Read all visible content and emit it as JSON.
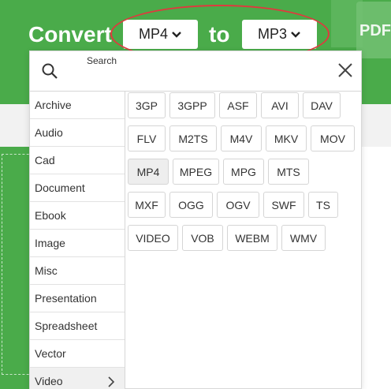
{
  "header": {
    "convert_label": "Convert",
    "to_label": "to",
    "from_format": "MP4",
    "to_format": "MP3",
    "badge_text": "PDF"
  },
  "search": {
    "label": "Search",
    "value": "",
    "placeholder": ""
  },
  "categories": [
    {
      "label": "Archive"
    },
    {
      "label": "Audio"
    },
    {
      "label": "Cad"
    },
    {
      "label": "Document"
    },
    {
      "label": "Ebook"
    },
    {
      "label": "Image"
    },
    {
      "label": "Misc"
    },
    {
      "label": "Presentation"
    },
    {
      "label": "Spreadsheet"
    },
    {
      "label": "Vector"
    },
    {
      "label": "Video",
      "active": true
    }
  ],
  "formats": [
    [
      "3GP",
      "3GPP",
      "ASF",
      "AVI",
      "DAV"
    ],
    [
      "FLV",
      "M2TS",
      "M4V",
      "MKV",
      "MOV"
    ],
    [
      "MP4",
      "MPEG",
      "MPG",
      "MTS"
    ],
    [
      "MXF",
      "OGG",
      "OGV",
      "SWF",
      "TS"
    ],
    [
      "VIDEO",
      "VOB",
      "WEBM",
      "WMV"
    ]
  ],
  "selected_format": "MP4",
  "colors": {
    "brand_green": "#4aab4a",
    "highlight_red": "#e0393e"
  }
}
